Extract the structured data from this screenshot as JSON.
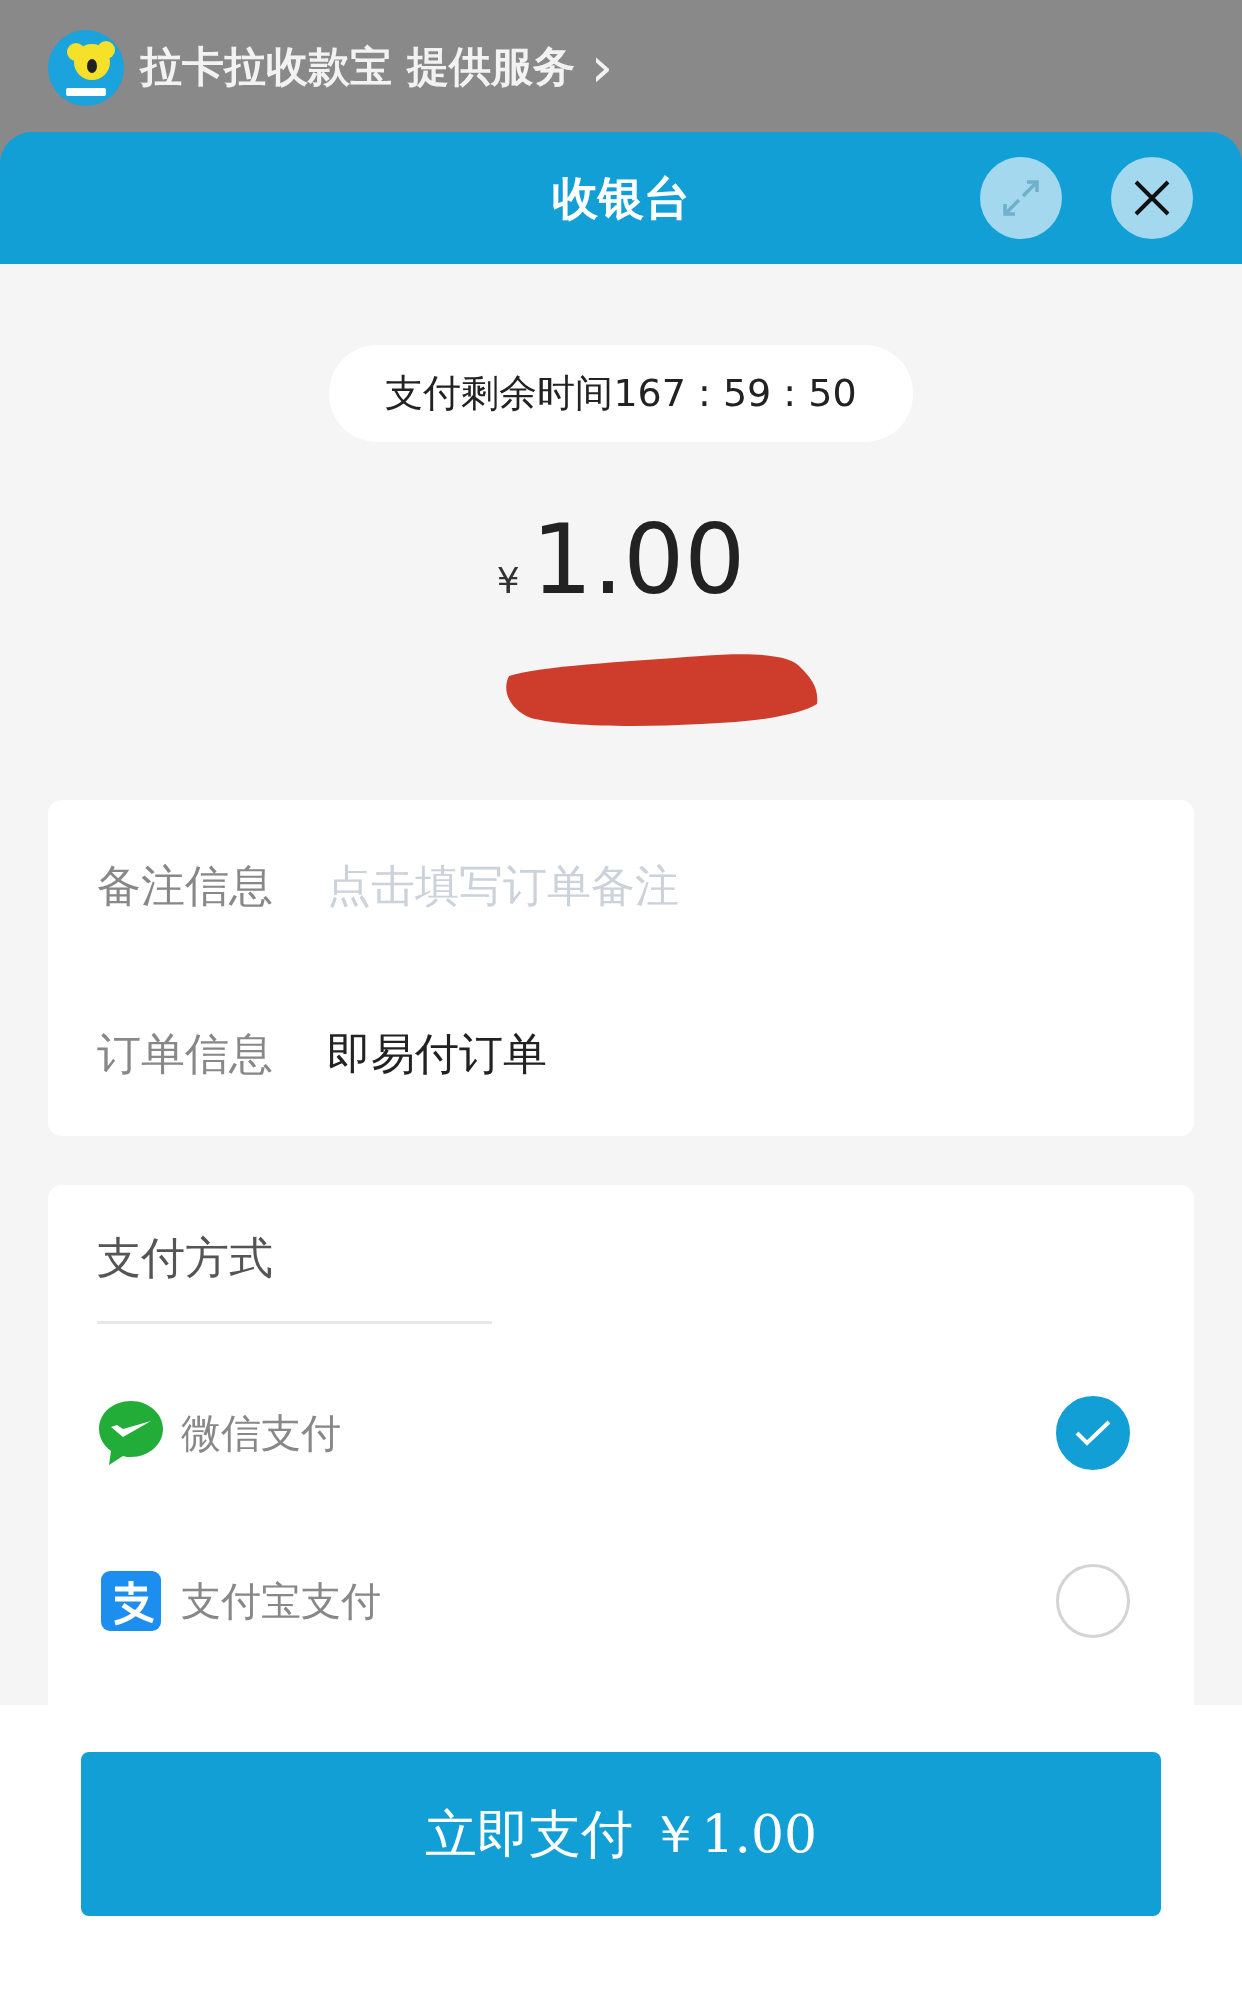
{
  "provider": {
    "text": "拉卡拉收款宝 提供服务",
    "chevron": "›"
  },
  "header": {
    "title": "收银台"
  },
  "timer": "支付剩余时间167 : 59 : 50",
  "amount": {
    "currency": "¥",
    "value": "1.00"
  },
  "order_fields": [
    {
      "label": "备注信息",
      "kind": "input",
      "placeholder": "点击填写订单备注"
    },
    {
      "label": "订单信息",
      "kind": "text",
      "value": "即易付订单"
    }
  ],
  "payment": {
    "title": "支付方式",
    "methods": [
      {
        "name": "微信支付",
        "kind": "wechat",
        "selected": true
      },
      {
        "name": "支付宝支付",
        "kind": "alipay",
        "selected": false
      }
    ]
  },
  "pay_button": "立即支付 ￥1.00"
}
